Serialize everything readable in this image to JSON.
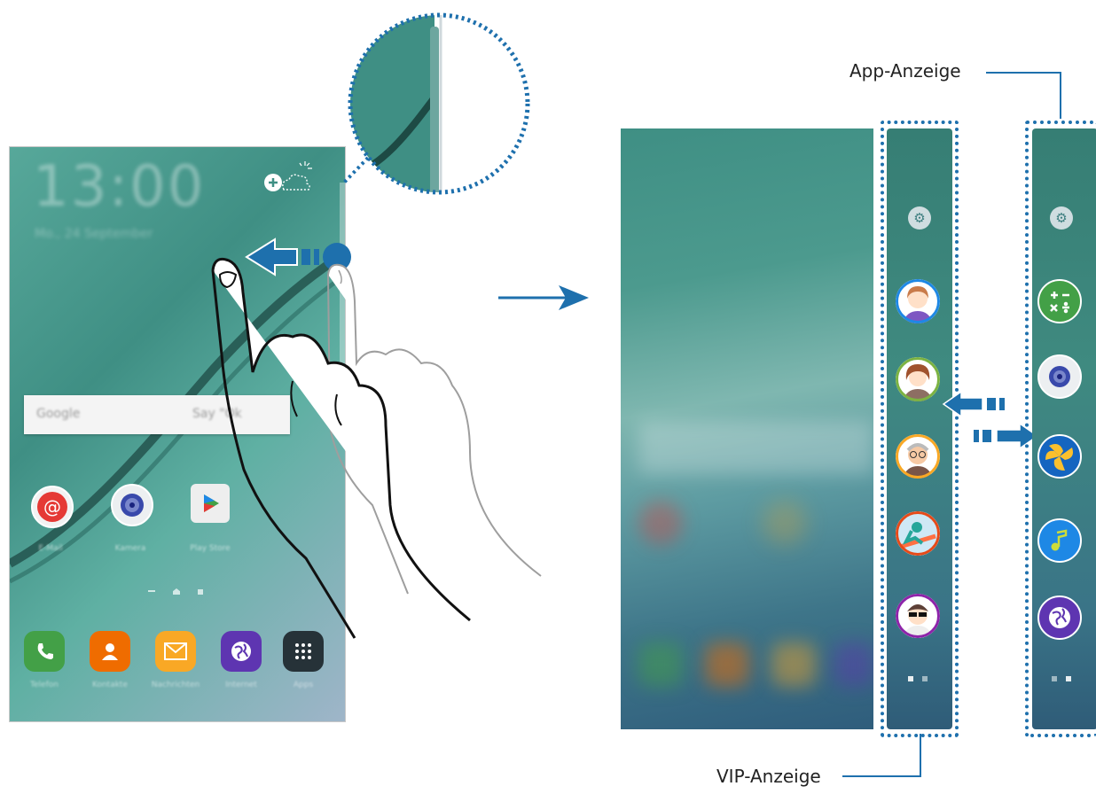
{
  "phone": {
    "clock": "13:00",
    "date": "Mo., 24 September",
    "search_logo": "Google",
    "search_hint": "Say \"Ok",
    "apps": [
      {
        "label": "E-Mail",
        "icon": "email-icon",
        "color": "#e53935"
      },
      {
        "label": "Kamera",
        "icon": "camera-icon",
        "color": "#5c6bc0"
      },
      {
        "label": "Play Store",
        "icon": "play-store-icon",
        "color": "#e0e0e0"
      }
    ],
    "dock": [
      {
        "label": "Telefon",
        "icon": "phone-icon",
        "color": "#43a047"
      },
      {
        "label": "Kontakte",
        "icon": "contacts-icon",
        "color": "#ef6c00"
      },
      {
        "label": "Nachrichten",
        "icon": "messages-icon",
        "color": "#f9a825"
      },
      {
        "label": "Internet",
        "icon": "internet-icon",
        "color": "#5e35b1"
      },
      {
        "label": "Apps",
        "icon": "apps-grid-icon",
        "color": "#263238"
      }
    ]
  },
  "labels": {
    "app_panel": "App-Anzeige",
    "vip_panel": "VIP-Anzeige"
  },
  "colors": {
    "accent": "#1e70ad"
  },
  "vip_contacts": [
    {
      "icon": "contact-avatar-girl-icon",
      "ring": "#1e88e5"
    },
    {
      "icon": "contact-avatar-woman-icon",
      "ring": "#7cb342"
    },
    {
      "icon": "contact-avatar-man-glasses-icon",
      "ring": "#f9a825"
    },
    {
      "icon": "contact-avatar-snowboarder-icon",
      "ring": "#e64a19"
    },
    {
      "icon": "contact-avatar-sunglasses-icon",
      "ring": "#8e24aa"
    }
  ],
  "edge_apps": [
    {
      "icon": "calculator-icon",
      "color": "#43a047"
    },
    {
      "icon": "camera-icon",
      "color": "#b0bec5"
    },
    {
      "icon": "gallery-icon",
      "color": "#1565c0"
    },
    {
      "icon": "music-icon",
      "color": "#1e88e5"
    },
    {
      "icon": "internet-icon",
      "color": "#5e35b1"
    }
  ]
}
